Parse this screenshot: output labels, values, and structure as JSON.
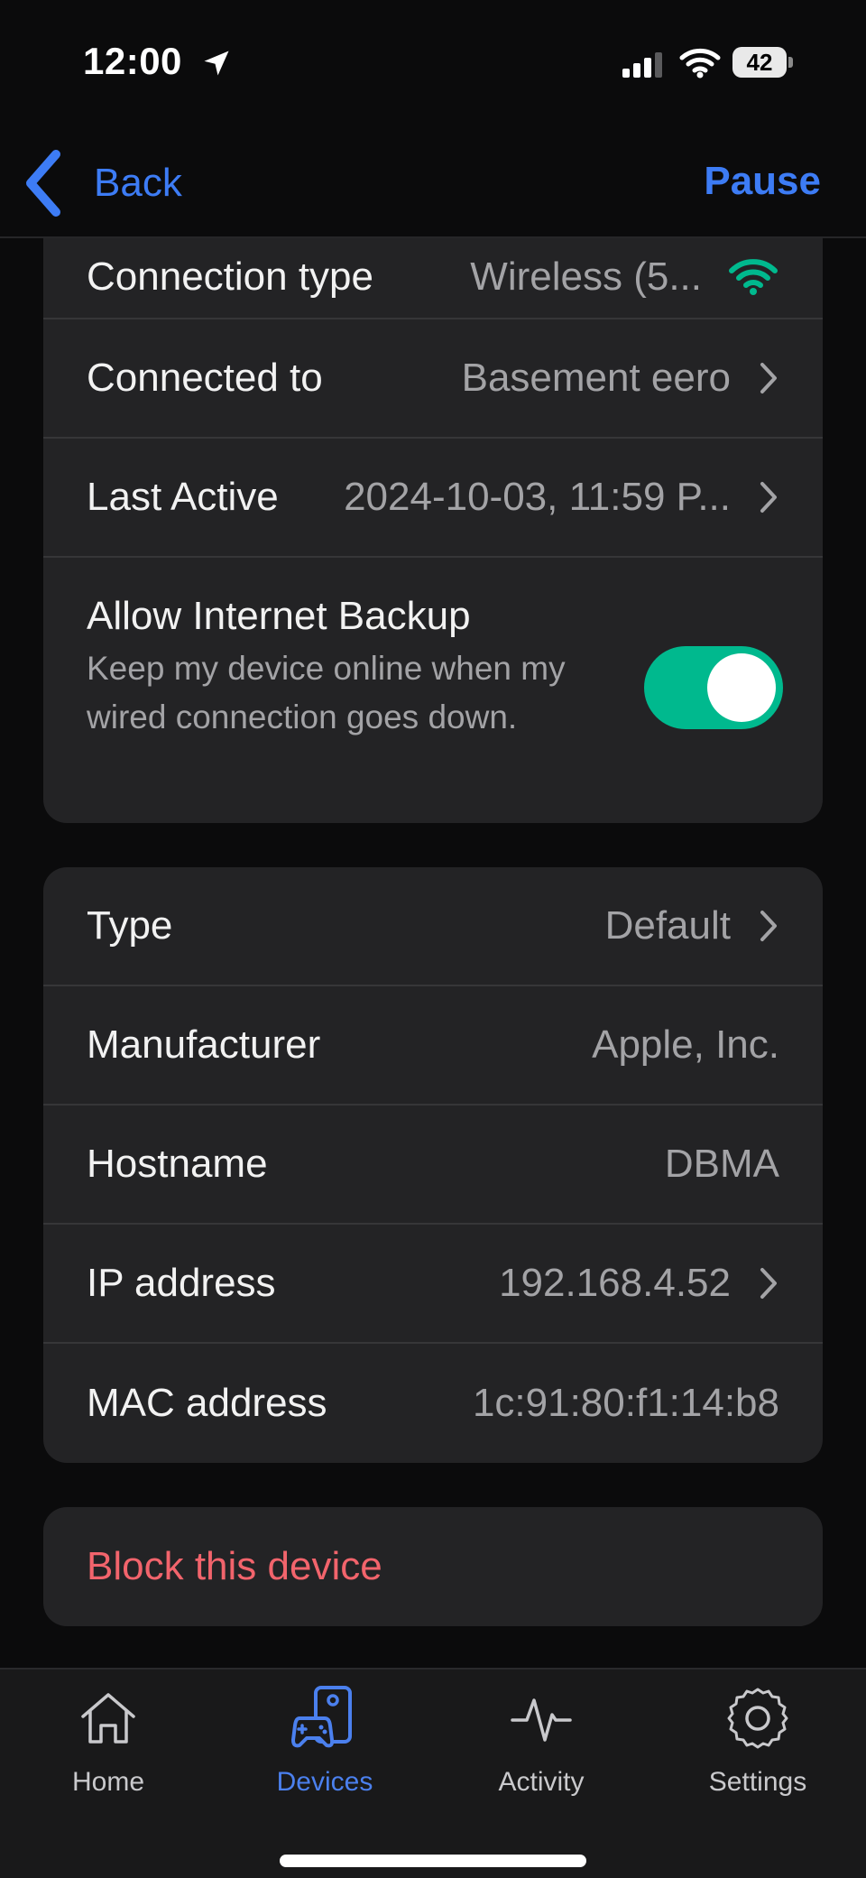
{
  "status_bar": {
    "time": "12:00",
    "battery": "42"
  },
  "nav": {
    "back_label": "Back",
    "pause_label": "Pause"
  },
  "connection_card": {
    "rows": [
      {
        "label": "Connection type",
        "value": "Wireless (5..."
      },
      {
        "label": "Connected to",
        "value": "Basement eero"
      },
      {
        "label": "Last Active",
        "value": "2024-10-03, 11:59 P..."
      }
    ],
    "backup": {
      "title": "Allow Internet Backup",
      "description": "Keep my device online when my wired connection goes down.",
      "enabled": true
    }
  },
  "details_card": {
    "rows": [
      {
        "label": "Type",
        "value": "Default"
      },
      {
        "label": "Manufacturer",
        "value": "Apple, Inc."
      },
      {
        "label": "Hostname",
        "value": "DBMA"
      },
      {
        "label": "IP address",
        "value": "192.168.4.52"
      },
      {
        "label": "MAC address",
        "value": "1c:91:80:f1:14:b8"
      }
    ]
  },
  "block": {
    "label": "Block this device"
  },
  "tabs": [
    {
      "label": "Home",
      "icon": "home-icon",
      "active": false
    },
    {
      "label": "Devices",
      "icon": "devices-icon",
      "active": true
    },
    {
      "label": "Activity",
      "icon": "activity-icon",
      "active": false
    },
    {
      "label": "Settings",
      "icon": "settings-icon",
      "active": false
    }
  ],
  "colors": {
    "accent": "#3d7cf5",
    "toggle_on": "#00b98e",
    "danger": "#f2646c",
    "wifi_signal": "#00b98e"
  }
}
